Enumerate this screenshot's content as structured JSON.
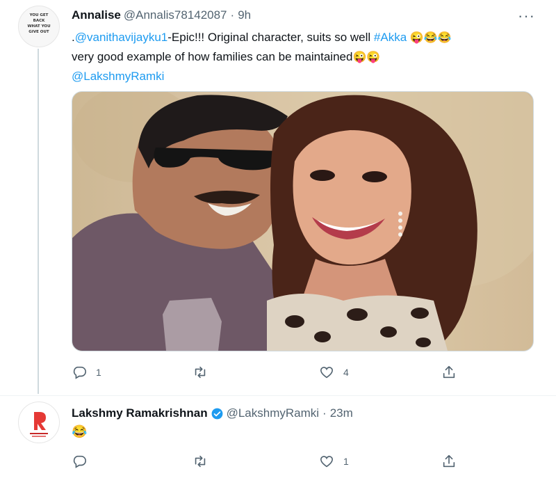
{
  "tweet1": {
    "avatar_text": "YOU GET BACK\nWHAT YOU\nGIVE OUT",
    "name": "Annalise",
    "handle": "@Annalis78142087",
    "separator": "·",
    "time": "9h",
    "more": "···",
    "text": {
      "prefix": ".",
      "mention1": "@vanithavijayku1",
      "part1": "-Epic!!! Original character, suits so well ",
      "hashtag": "#Akka",
      "emoji1": "😜😂😂",
      "part2": "very good example of how families can be maintained",
      "emoji2": "😜😜",
      "mention2": "@LakshmyRamki"
    },
    "actions": {
      "replies": "1",
      "retweets": "",
      "likes": "4"
    }
  },
  "tweet2": {
    "name": "Lakshmy Ramakrishnan",
    "handle": "@LakshmyRamki",
    "separator": "·",
    "time": "23m",
    "text": "😂",
    "actions": {
      "replies": "",
      "retweets": "",
      "likes": "1"
    }
  },
  "colors": {
    "link": "#1d9bf0",
    "muted": "#536471",
    "verified": "#1d9bf0",
    "avatar_red": "#e53935"
  },
  "icons": [
    "reply-icon",
    "retweet-icon",
    "like-icon",
    "share-icon",
    "verified-icon",
    "more-icon"
  ]
}
